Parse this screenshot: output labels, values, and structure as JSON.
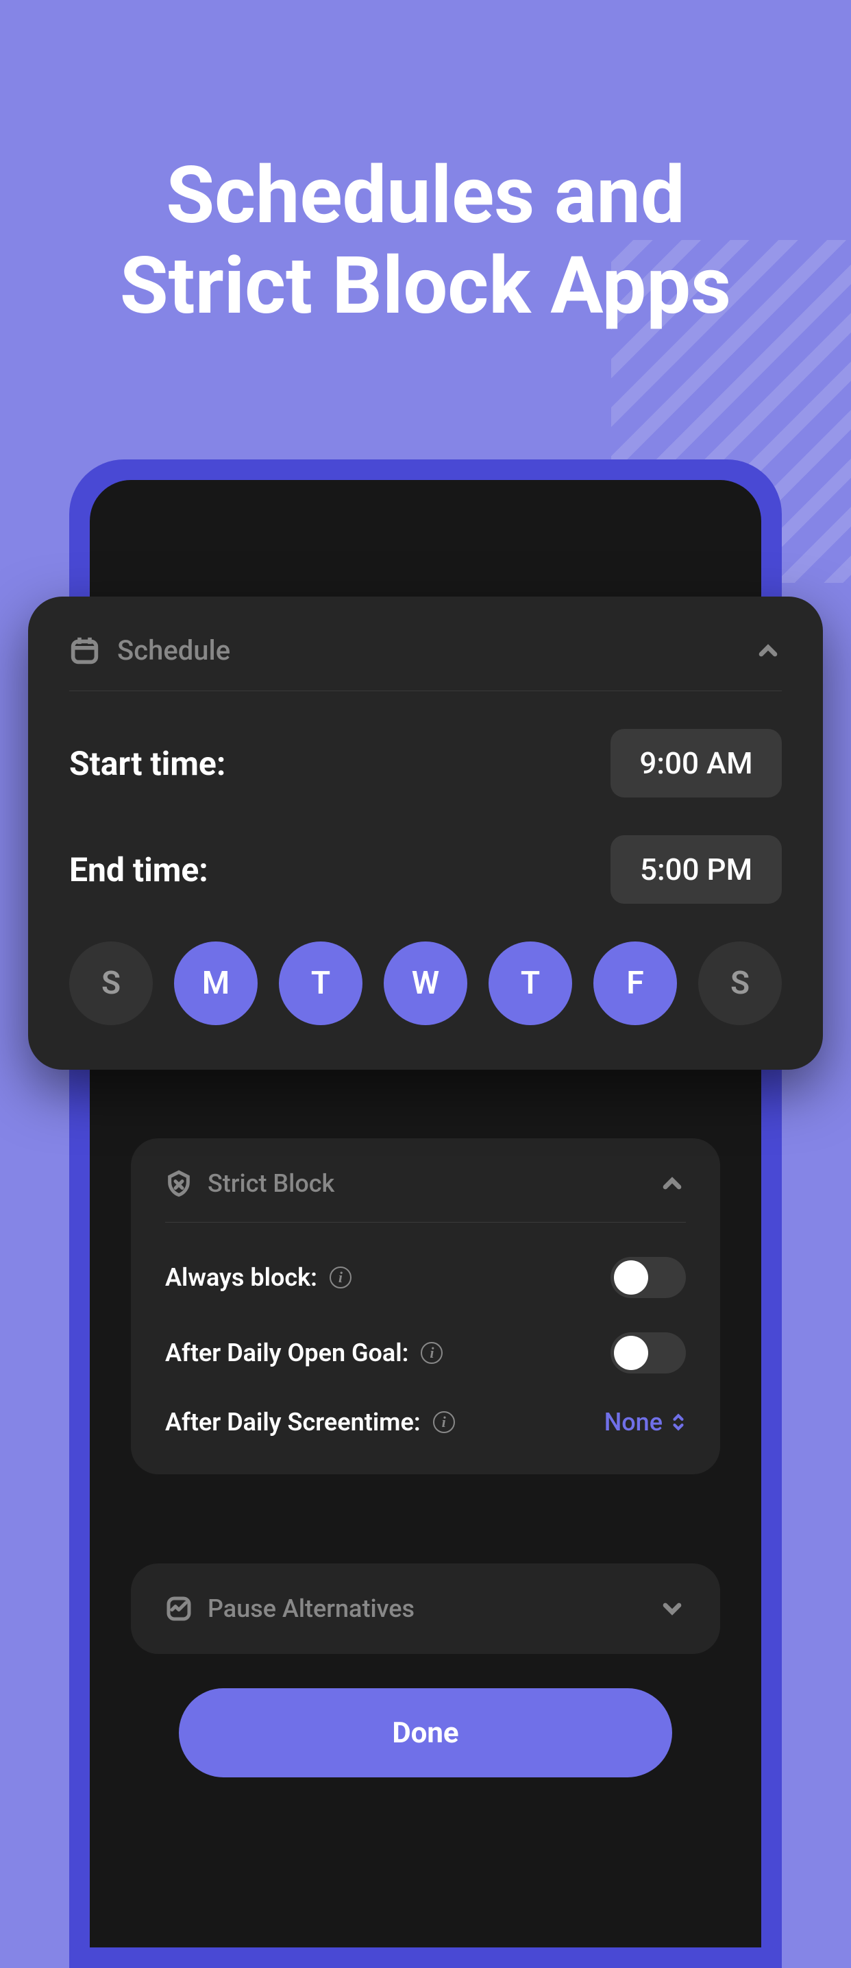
{
  "hero": {
    "title_line1": "Schedules and",
    "title_line2": "Strict Block Apps"
  },
  "schedule": {
    "title": "Schedule",
    "start_label": "Start time:",
    "start_value": "9:00 AM",
    "end_label": "End time:",
    "end_value": "5:00 PM",
    "days": [
      {
        "label": "S",
        "active": false
      },
      {
        "label": "M",
        "active": true
      },
      {
        "label": "T",
        "active": true
      },
      {
        "label": "W",
        "active": true
      },
      {
        "label": "T",
        "active": true
      },
      {
        "label": "F",
        "active": true
      },
      {
        "label": "S",
        "active": false
      }
    ]
  },
  "strict_block": {
    "title": "Strict Block",
    "always_label": "Always block:",
    "daily_open_label": "After Daily Open Goal:",
    "screentime_label": "After Daily Screentime:",
    "screentime_value": "None"
  },
  "pause": {
    "title": "Pause Alternatives"
  },
  "done_label": "Done"
}
